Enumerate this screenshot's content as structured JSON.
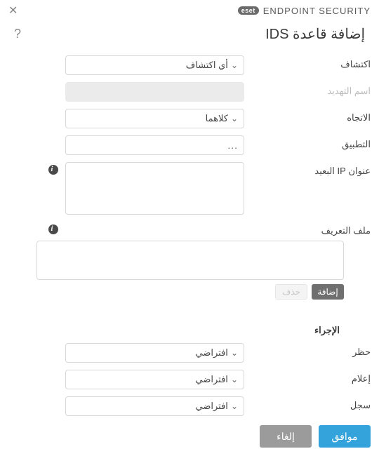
{
  "brand": {
    "badge": "eset",
    "name": "ENDPOINT SECURITY"
  },
  "title": "إضافة قاعدة IDS",
  "help": "?",
  "labels": {
    "detection": "اكتشاف",
    "threat_name": "اسم التهديد",
    "direction": "الاتجاه",
    "application": "التطبيق",
    "remote_ip": "عنوان IP البعيد",
    "profile": "ملف التعريف",
    "action_section": "الإجراء",
    "block": "حظر",
    "notify": "إعلام",
    "log": "سجل"
  },
  "values": {
    "detection": "أي اكتشاف",
    "threat_name": "",
    "direction": "كلاهما",
    "application": "",
    "remote_ip": "",
    "block": "افتراضي",
    "notify": "افتراضي",
    "log": "افتراضي"
  },
  "buttons": {
    "add": "إضافة",
    "delete": "حذف",
    "ok": "موافق",
    "cancel": "إلغاء"
  }
}
